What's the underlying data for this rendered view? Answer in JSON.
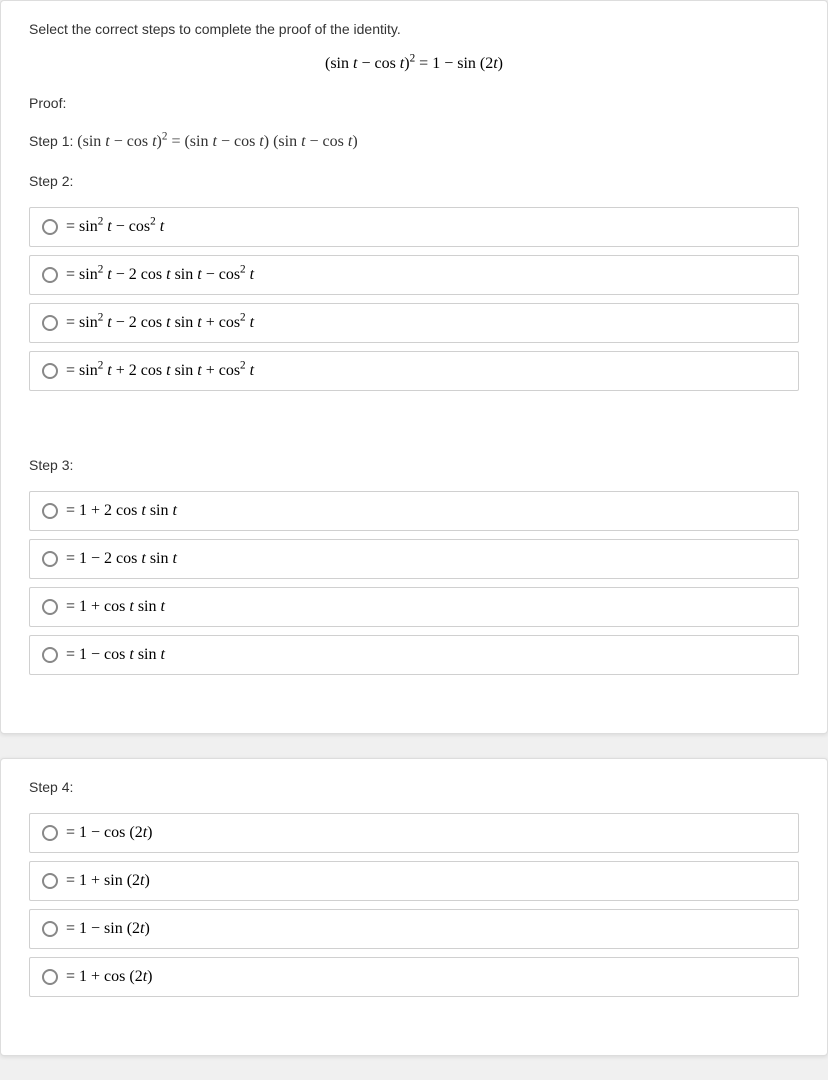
{
  "instruction": "Select the correct steps to complete the proof of the identity.",
  "identity_html": "(sin <i>t</i> − cos <i>t</i>)<sup>2</sup> = 1 − sin (2<i>t</i>)",
  "proof_label": "Proof:",
  "step1_label": "Step 1:",
  "step1_html": "(sin <i>t</i> − cos <i>t</i>)<sup>2</sup> = (sin <i>t</i> − cos <i>t</i>) (sin <i>t</i> − cos <i>t</i>)",
  "step2_label": "Step 2:",
  "step2_options": [
    "= sin<sup>2</sup> <i>t</i> − cos<sup>2</sup> <i>t</i>",
    "= sin<sup>2</sup> <i>t</i> − 2 cos <i>t</i> sin <i>t</i> − cos<sup>2</sup> <i>t</i>",
    "= sin<sup>2</sup> <i>t</i> − 2 cos <i>t</i> sin <i>t</i> + cos<sup>2</sup> <i>t</i>",
    "= sin<sup>2</sup> <i>t</i> + 2 cos <i>t</i> sin <i>t</i> + cos<sup>2</sup> <i>t</i>"
  ],
  "step3_label": "Step 3:",
  "step3_options": [
    "= 1 + 2 cos <i>t</i> sin <i>t</i>",
    "= 1 − 2 cos <i>t</i> sin <i>t</i>",
    "= 1 + cos <i>t</i> sin <i>t</i>",
    "= 1 − cos <i>t</i> sin <i>t</i>"
  ],
  "step4_label": "Step 4:",
  "step4_options": [
    "= 1 − cos (2<i>t</i>)",
    "= 1 + sin (2<i>t</i>)",
    "= 1 − sin (2<i>t</i>)",
    "= 1 + cos (2<i>t</i>)"
  ]
}
